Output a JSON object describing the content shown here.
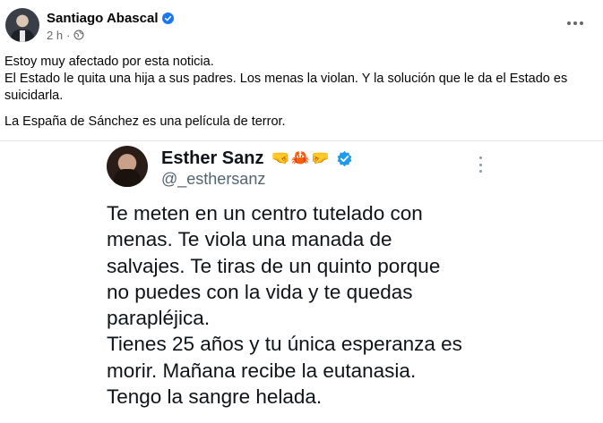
{
  "post": {
    "author": "Santiago Abascal",
    "time": "2 h",
    "dot": "·",
    "paragraphs": [
      "Estoy muy afectado por esta noticia.",
      "El Estado le quita una hija a sus padres. Los menas la violan. Y la solución que le da el Estado es suicidarla.",
      "La España de Sánchez es una película de terror."
    ]
  },
  "tweet": {
    "name": "Esther Sanz",
    "emoji": "🤜🦀🤛",
    "handle": "@_esthersanz",
    "lines": [
      "Te meten en un centro tutelado con",
      "menas. Te viola una manada de",
      "salvajes. Te tiras de un quinto porque",
      "no puedes con la vida y te quedas",
      "parapléjica.",
      "Tienes 25 años y tu única esperanza es",
      "morir. Mañana recibe la eutanasia.",
      "Tengo la sangre helada."
    ]
  },
  "colors": {
    "facebook_verified": "#1877f2",
    "twitter_verified": "#1d9bf0",
    "secondary_text": "#65676b"
  },
  "icons": {
    "post_more": "more-horizontal-icon",
    "tweet_more": "more-vertical-icon",
    "audience": "globe-icon",
    "verified": "verified-badge-icon"
  }
}
